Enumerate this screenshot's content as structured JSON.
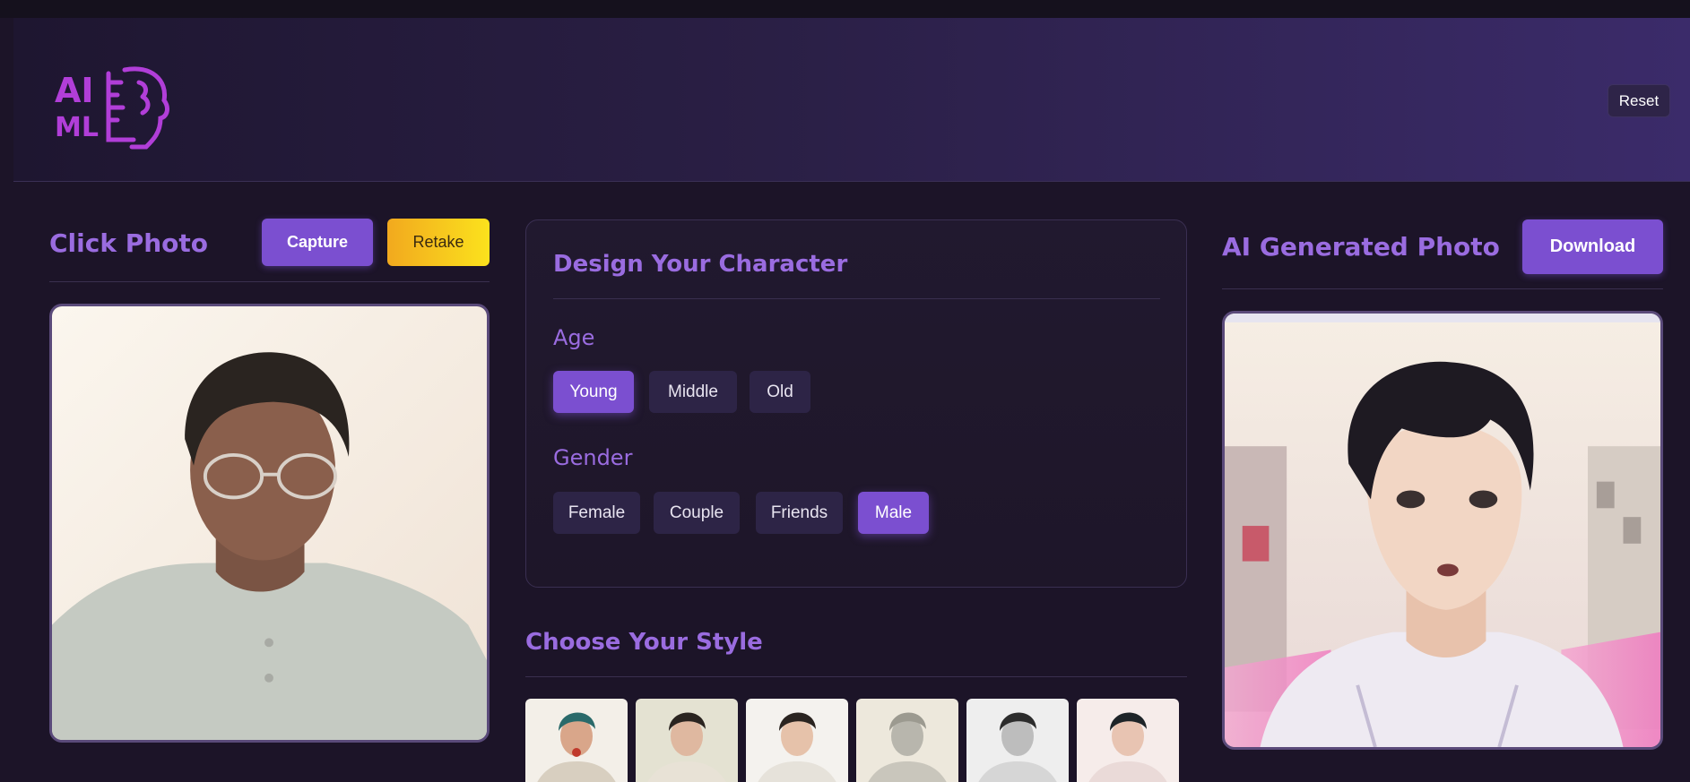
{
  "header": {
    "logo_text_top": "AI",
    "logo_text_bottom": "ML",
    "reset_label": "Reset"
  },
  "left": {
    "title": "Click Photo",
    "capture_label": "Capture",
    "retake_label": "Retake"
  },
  "design": {
    "title": "Design Your Character",
    "age_label": "Age",
    "age_options": [
      "Young",
      "Middle",
      "Old"
    ],
    "age_selected": "Young",
    "gender_label": "Gender",
    "gender_options": [
      "Female",
      "Couple",
      "Friends",
      "Male"
    ],
    "gender_selected": "Male"
  },
  "style": {
    "title": "Choose Your Style",
    "thumbnails": [
      "style-1",
      "style-2",
      "style-3",
      "style-4",
      "style-5",
      "style-6"
    ]
  },
  "right": {
    "title": "AI Generated Photo",
    "download_label": "Download"
  },
  "colors": {
    "accent": "#7b4fd0",
    "heading": "#9a6ce0",
    "background": "#1c1428",
    "retake_start": "#f2a91e",
    "retake_end": "#fbe21d"
  }
}
